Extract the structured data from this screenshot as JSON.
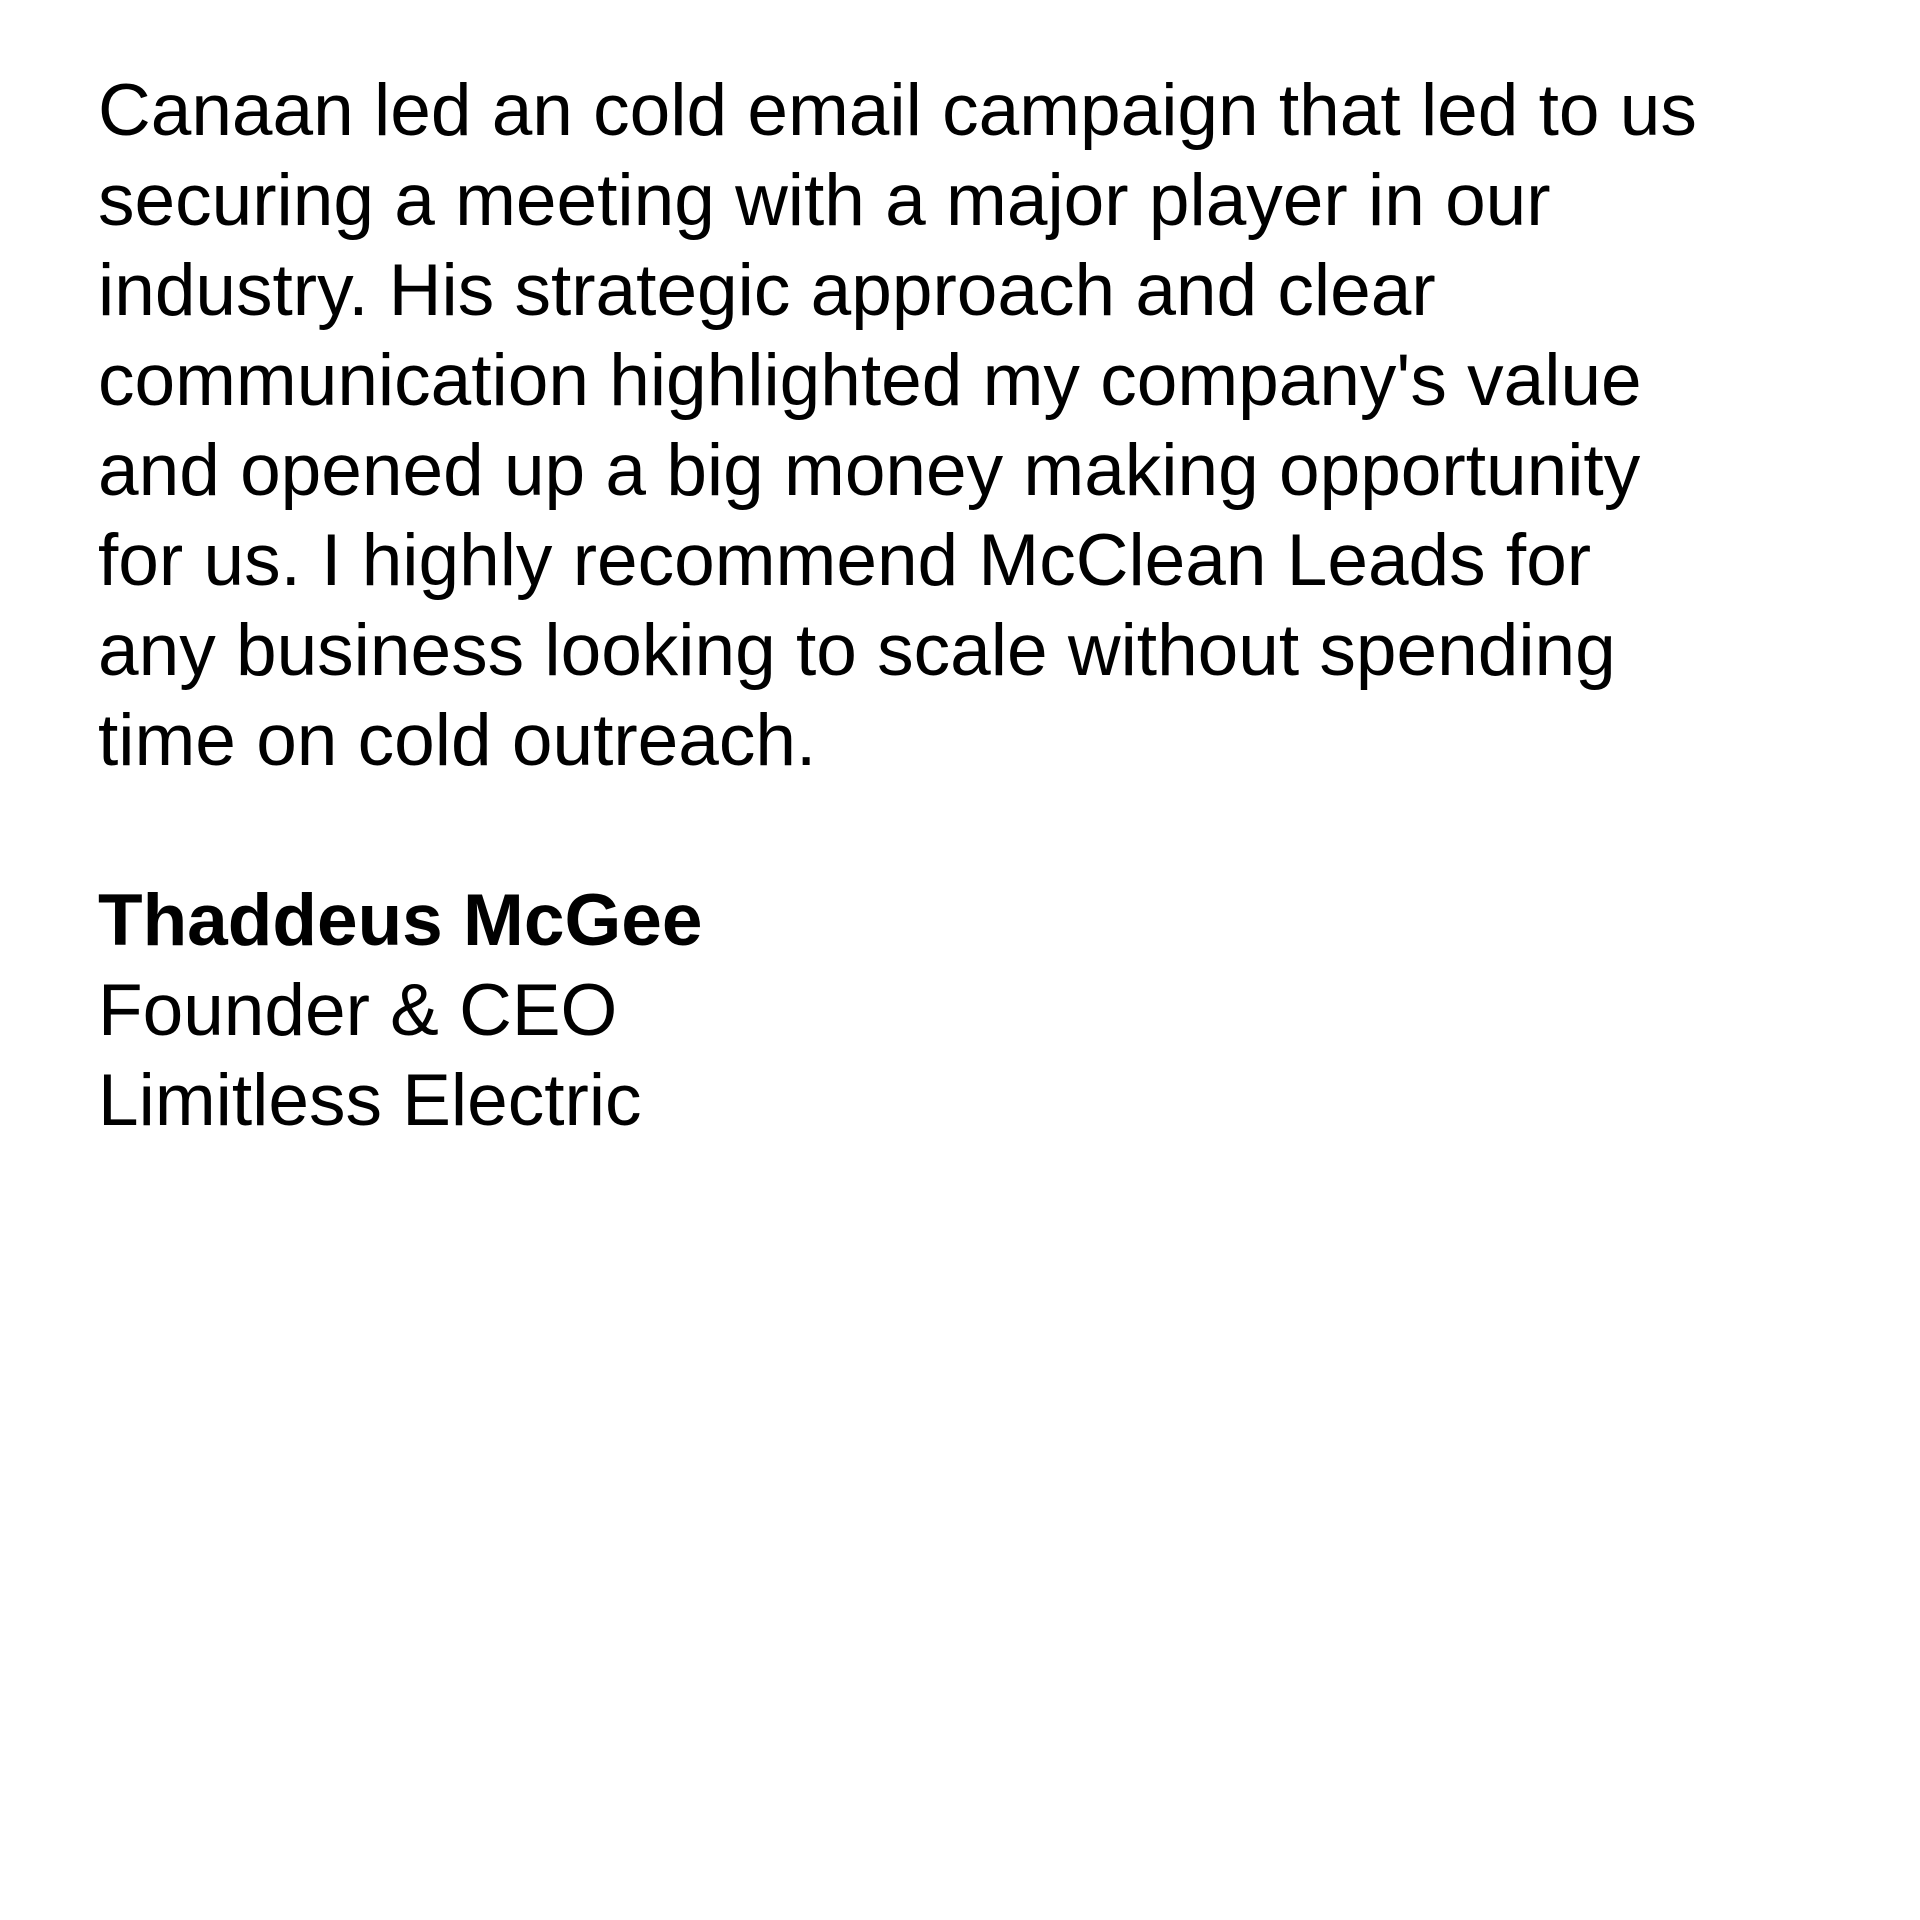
{
  "testimonial": {
    "quote_lines": [
      "Canaan led an cold email campaign that led to us",
      "securing a meeting with a major player in our",
      "industry. His strategic approach and clear",
      "communication highlighted my company's value",
      "and opened up a big money making opportunity",
      "for us. I highly recommend McClean Leads for",
      "any business looking to scale without spending",
      "time on cold outreach."
    ],
    "author": {
      "name": "Thaddeus McGee",
      "role": "Founder & CEO",
      "company": "Limitless Electric"
    }
  }
}
